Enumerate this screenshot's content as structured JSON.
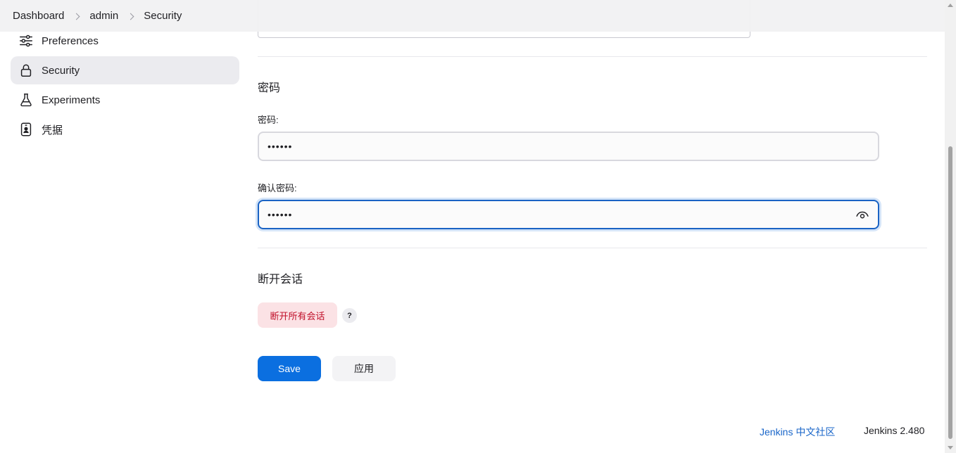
{
  "breadcrumb": {
    "items": [
      "Dashboard",
      "admin",
      "Security"
    ]
  },
  "sidebar": {
    "items": [
      {
        "label": "Preferences",
        "icon": "sliders-icon"
      },
      {
        "label": "Security",
        "icon": "lock-icon",
        "active": true
      },
      {
        "label": "Experiments",
        "icon": "flask-icon"
      },
      {
        "label": "凭据",
        "icon": "id-badge-icon"
      }
    ]
  },
  "password_section": {
    "title": "密码",
    "password_label": "密码:",
    "password_value": "••••••",
    "confirm_label": "确认密码:",
    "confirm_value": "••••••"
  },
  "sessions_section": {
    "title": "断开会话",
    "disconnect_button": "断开所有会话",
    "help_label": "?"
  },
  "actions": {
    "save_label": "Save",
    "apply_label": "应用"
  },
  "footer": {
    "community_link": "Jenkins 中文社区",
    "version": "Jenkins 2.480"
  },
  "colors": {
    "primary": "#0b6fe0",
    "danger_text": "#c1102a",
    "danger_bg": "#fbe2e5",
    "focus_border": "#1a63c4"
  }
}
